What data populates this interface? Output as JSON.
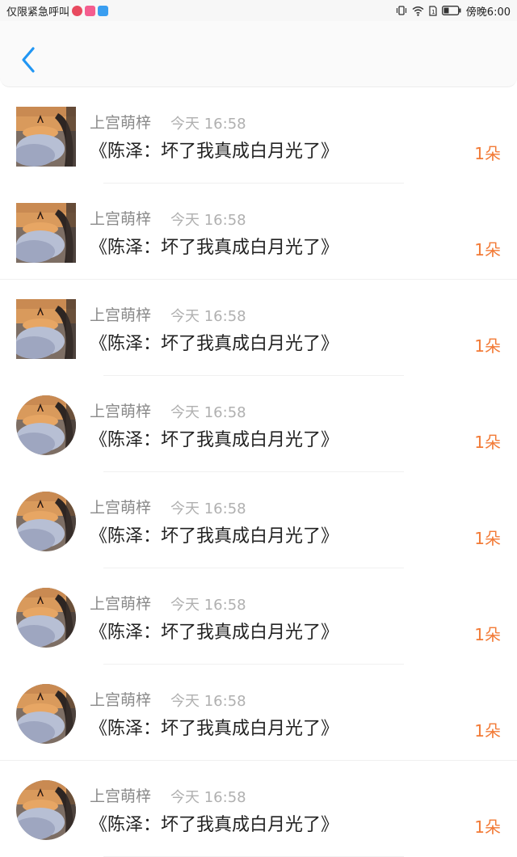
{
  "status_bar": {
    "left_text": "仅限紧急呼叫",
    "right_text": "傍晚6:00",
    "icons": [
      "app-badge-red",
      "app-badge-pink",
      "app-badge-blue",
      "vibrate-icon",
      "wifi-icon",
      "sim-icon",
      "battery-icon"
    ]
  },
  "header": {
    "back_icon": "chevron-left-icon",
    "accent": "#2196f3"
  },
  "colors": {
    "count": "#f27a36",
    "name": "#8a8a8a",
    "time": "#b0b0b0",
    "title": "#222222"
  },
  "items": [
    {
      "name": "上宫萌梓",
      "time": "今天 16:58",
      "title": "《陈泽：坏了我真成白月光了》",
      "count": "1朵",
      "avatar": "square"
    },
    {
      "name": "上宫萌梓",
      "time": "今天 16:58",
      "title": "《陈泽：坏了我真成白月光了》",
      "count": "1朵",
      "avatar": "square"
    },
    {
      "name": "上宫萌梓",
      "time": "今天 16:58",
      "title": "《陈泽：坏了我真成白月光了》",
      "count": "1朵",
      "avatar": "square"
    },
    {
      "name": "上宫萌梓",
      "time": "今天 16:58",
      "title": "《陈泽：坏了我真成白月光了》",
      "count": "1朵",
      "avatar": "round"
    },
    {
      "name": "上宫萌梓",
      "time": "今天 16:58",
      "title": "《陈泽：坏了我真成白月光了》",
      "count": "1朵",
      "avatar": "round"
    },
    {
      "name": "上宫萌梓",
      "time": "今天 16:58",
      "title": "《陈泽：坏了我真成白月光了》",
      "count": "1朵",
      "avatar": "round"
    },
    {
      "name": "上宫萌梓",
      "time": "今天 16:58",
      "title": "《陈泽：坏了我真成白月光了》",
      "count": "1朵",
      "avatar": "round"
    },
    {
      "name": "上宫萌梓",
      "time": "今天 16:58",
      "title": "《陈泽：坏了我真成白月光了》",
      "count": "1朵",
      "avatar": "round"
    }
  ]
}
